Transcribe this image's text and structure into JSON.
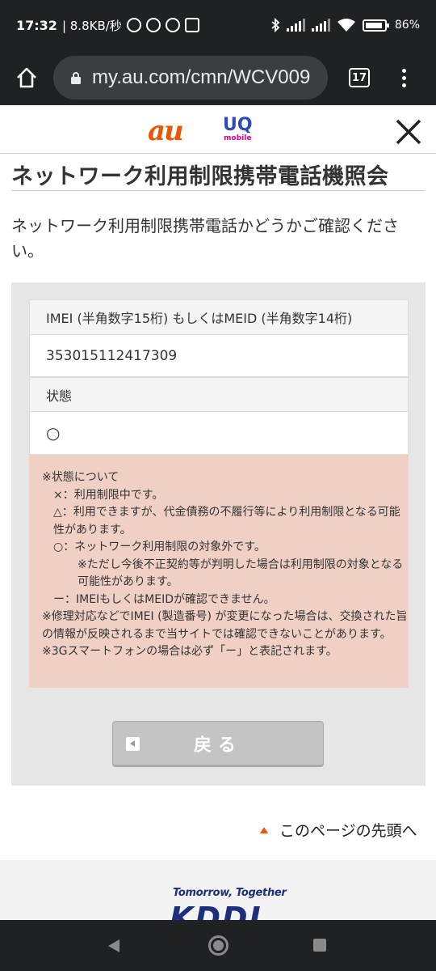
{
  "status_bar": {
    "time": "17:32",
    "net_speed": "| 8.8KB/秒",
    "battery": "86%"
  },
  "browser": {
    "url": "my.au.com/cmn/WCV009",
    "tab_count": "17"
  },
  "header": {
    "logo_au": "au",
    "logo_uq": "UQ",
    "logo_uq_sub": "mobile"
  },
  "page": {
    "title": "ネットワーク利用制限携帯電話機照会",
    "lead": "ネットワーク利用制限携帯電話かどうかご確認ください。"
  },
  "form": {
    "imei_label": "IMEI (半角数字15桁) もしくはMEID (半角数字14桁)",
    "imei_value": "353015112417309",
    "status_label": "状態",
    "status_value": "○"
  },
  "notes": {
    "heading": "※状態について",
    "x_line": "×：利用制限中です。",
    "triangle_line": "△：利用できますが、代金債務の不履行等により利用制限となる可能性があります。",
    "circle_line": "○：ネットワーク利用制限の対象外です。",
    "circle_sub": "※ただし今後不正契約等が判明した場合は利用制限の対象となる可能性があります。",
    "dash_line": "ー：IMEIもしくはMEIDが確認できません。",
    "repair_note": "※修理対応などでIMEI (製造番号) が変更になった場合は、交換された旨の情報が反映されるまで当サイトでは確認できないことがあります。",
    "3g_note": "※3Gスマートフォンの場合は必ず「ー」と表記されます。"
  },
  "buttons": {
    "back": "戻る"
  },
  "links": {
    "page_top": "このページの先頭へ"
  },
  "footer": {
    "tagline": "Tomorrow, Together",
    "brand": "KDDI"
  },
  "colors": {
    "au_orange": "#eb5505",
    "note_bg": "#f0d0c4",
    "kddi_blue": "#1d2f7b"
  }
}
